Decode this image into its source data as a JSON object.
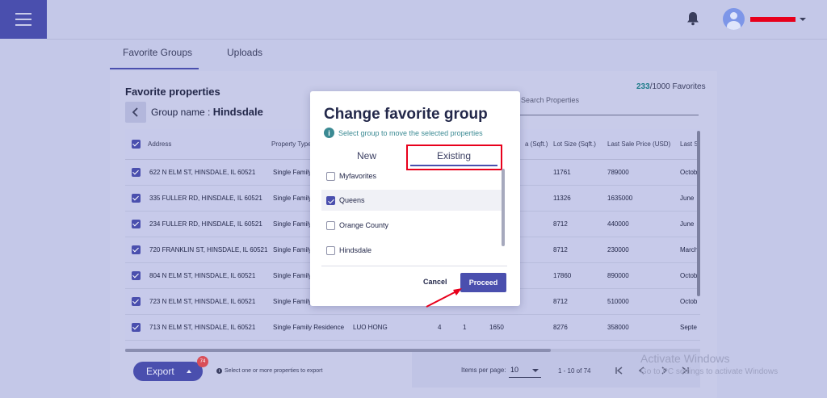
{
  "header": {
    "menu_icon": "hamburger-menu-icon",
    "bell_icon": "bell-icon",
    "avatar_icon": "user-avatar-icon"
  },
  "tabs": [
    {
      "label": "Favorite Groups"
    },
    {
      "label": "Uploads"
    }
  ],
  "panel": {
    "title": "Favorite properties",
    "group_prefix": "Group name : ",
    "group_name": "Hindsdale",
    "fav_count": "233",
    "fav_total": "/1000 Favorites",
    "search_placeholder": "Search Properties"
  },
  "table": {
    "columns": [
      "Address",
      "Property Type",
      "a (Sqft.)",
      "Lot Size (Sqft.)",
      "Last Sale Price (USD)",
      "Last S"
    ],
    "rows": [
      {
        "address": "622 N ELM ST, HINSDALE, IL 60521",
        "type": "Single Family",
        "lot": "11761",
        "price": "789000",
        "last": "Octob"
      },
      {
        "address": "335 FULLER RD, HINSDALE, IL 60521",
        "type": "Single Family",
        "lot": "11326",
        "price": "1635000",
        "last": "June"
      },
      {
        "address": "234 FULLER RD, HINSDALE, IL 60521",
        "type": "Single Family",
        "lot": "8712",
        "price": "440000",
        "last": "June"
      },
      {
        "address": "720 FRANKLIN ST, HINSDALE, IL 60521",
        "type": "Single Family",
        "lot": "8712",
        "price": "230000",
        "last": "March"
      },
      {
        "address": "804 N ELM ST, HINSDALE, IL 60521",
        "type": "Single Family",
        "lot": "17860",
        "price": "890000",
        "last": "Octob"
      },
      {
        "address": "723 N ELM ST, HINSDALE, IL 60521",
        "type": "Single Family",
        "lot": "8712",
        "price": "510000",
        "last": "Octob"
      },
      {
        "address": "713 N ELM ST, HINSDALE, IL 60521",
        "type": "Single Family Residence",
        "owner": "LUO HONG",
        "beds": "4",
        "baths": "1",
        "area": "1650",
        "lot": "8276",
        "price": "358000",
        "last": "Septe"
      }
    ]
  },
  "footer": {
    "export_label": "Export",
    "export_badge": "74",
    "export_hint": "Select one or more properties to export",
    "items_per_page_label": "Items per page:",
    "items_per_page_value": "10",
    "range": "1 - 10 of 74",
    "first_icon": "first-page-icon",
    "prev_icon": "prev-page-icon",
    "next_icon": "next-page-icon",
    "last_icon": "last-page-icon"
  },
  "watermark": {
    "line1": "Activate Windows",
    "line2": "Go to PC settings to activate Windows"
  },
  "modal": {
    "title": "Change favorite group",
    "hint": "Select group to move the selected properties",
    "tab_new": "New",
    "tab_existing": "Existing",
    "groups": [
      {
        "label": "Myfavorites",
        "checked": false
      },
      {
        "label": "Queens",
        "checked": true
      },
      {
        "label": "Orange County",
        "checked": false
      },
      {
        "label": "Hindsdale",
        "checked": false
      }
    ],
    "cancel_label": "Cancel",
    "proceed_label": "Proceed"
  },
  "colors": {
    "accent": "#4a4fae",
    "background": "#c4c8e8",
    "annotation": "#e8001c",
    "teal": "#3b8a93"
  }
}
